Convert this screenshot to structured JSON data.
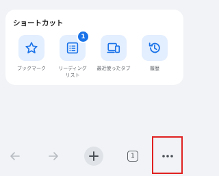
{
  "shortcuts": {
    "title": "ショートカット",
    "items": [
      {
        "label": "ブックマーク",
        "icon": "star-icon"
      },
      {
        "label": "リーディング\nリスト",
        "icon": "reading-list-icon",
        "badge": "1"
      },
      {
        "label": "最近使ったタブ",
        "icon": "devices-icon"
      },
      {
        "label": "履歴",
        "icon": "history-icon"
      }
    ]
  },
  "toolbar": {
    "tab_count": "1"
  },
  "colors": {
    "accent": "#1a73e8",
    "highlight": "#e02020",
    "tile_background": "#e3eefe"
  }
}
